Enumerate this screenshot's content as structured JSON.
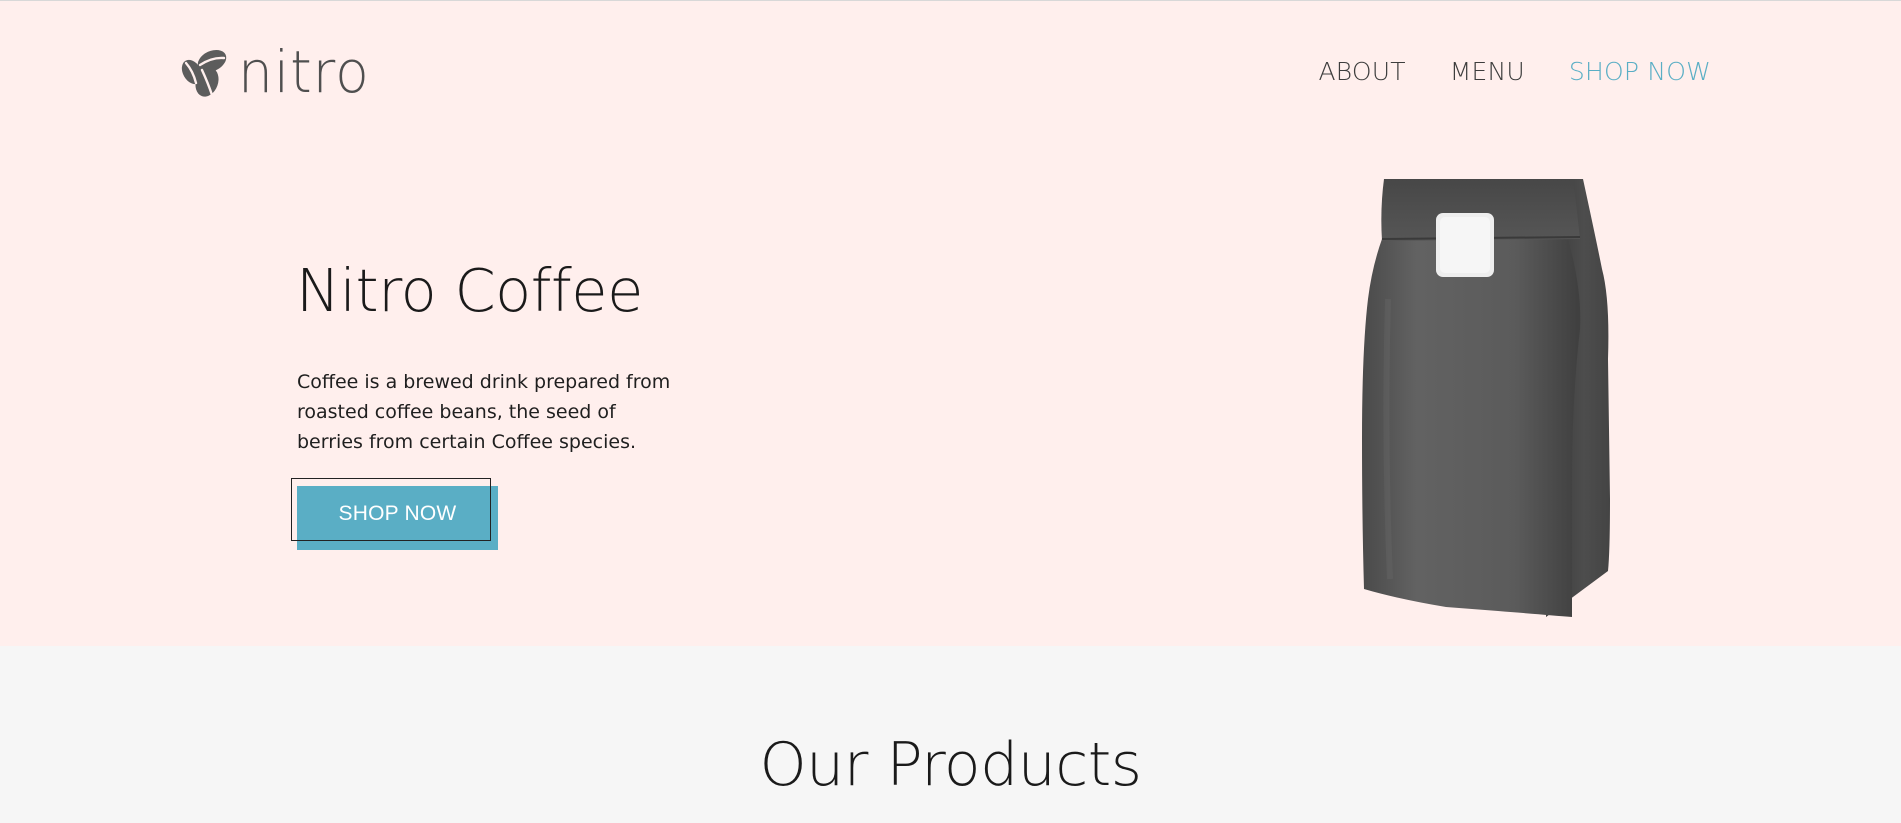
{
  "header": {
    "logo_text": "nitro",
    "logo_icon": "coffee-beans-icon",
    "nav": [
      {
        "label": "ABOUT",
        "active": false
      },
      {
        "label": "MENU",
        "active": false
      },
      {
        "label": "SHOP NOW",
        "active": true
      }
    ]
  },
  "hero": {
    "title": "Nitro Coffee",
    "description": "Coffee is a brewed drink prepared from roasted coffee beans, the seed of berries from certain Coffee species.",
    "cta_label": "SHOP NOW",
    "image": "coffee-bag"
  },
  "products": {
    "title": "Our Products"
  },
  "colors": {
    "hero_background": "#ffefed",
    "accent": "#5aaec5",
    "page_background": "#f6f6f6",
    "text": "#1a1a1a",
    "logo": "#4f4f4f"
  }
}
